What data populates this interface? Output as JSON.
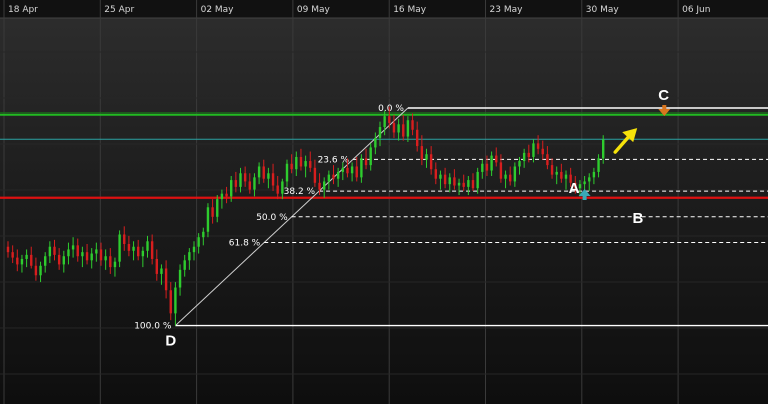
{
  "colors": {
    "up": "#2ecc2e",
    "down": "#d81e1e",
    "grid": "#3a3a3a",
    "fib_line": "#ffffff",
    "retracement_line": "#cfcfcf",
    "resistance_green": "#22bb22",
    "support_red": "#dd1111",
    "cyan_line": "#2aa3a3",
    "arrow_yellow": "#f5e20a",
    "marker_orange": "#d9761e",
    "marker_cyan": "#3aa9b5"
  },
  "chart_data": {
    "type": "candlestick",
    "x_labels": [
      "18 Apr",
      "25 Apr",
      "02 May",
      "09 May",
      "16 May",
      "23 May",
      "30 May",
      "06 Jun"
    ],
    "ylim": [
      1.2,
      1.45
    ],
    "fib_levels": [
      {
        "label": "0.0 %",
        "ratio": 0.0
      },
      {
        "label": "23.6 %",
        "ratio": 0.236
      },
      {
        "label": "38.2 %",
        "ratio": 0.382
      },
      {
        "label": "50.0 %",
        "ratio": 0.5
      },
      {
        "label": "61.8 %",
        "ratio": 0.618
      },
      {
        "label": "100.0 %",
        "ratio": 1.0
      }
    ],
    "fib_high": 1.4,
    "fib_low": 1.24,
    "levels": {
      "resistance_green": 1.395,
      "cyan": 1.377,
      "support_red": 1.334
    },
    "points": [
      {
        "label": "A",
        "index": 124,
        "price": 1.336,
        "marker": "up"
      },
      {
        "label": "B",
        "index": 133,
        "price": 1.328,
        "marker": "none"
      },
      {
        "label": "C",
        "index": 142,
        "price": 1.4,
        "marker": "down"
      },
      {
        "label": "D",
        "index": 36,
        "price": 1.24,
        "marker": "none"
      }
    ],
    "candles": [
      [
        1.298,
        1.302,
        1.29,
        1.294
      ],
      [
        1.294,
        1.299,
        1.286,
        1.29
      ],
      [
        1.29,
        1.296,
        1.28,
        1.285
      ],
      [
        1.285,
        1.292,
        1.279,
        1.289
      ],
      [
        1.289,
        1.296,
        1.283,
        1.292
      ],
      [
        1.292,
        1.298,
        1.282,
        1.284
      ],
      [
        1.284,
        1.29,
        1.273,
        1.277
      ],
      [
        1.277,
        1.287,
        1.272,
        1.284
      ],
      [
        1.284,
        1.294,
        1.279,
        1.291
      ],
      [
        1.291,
        1.302,
        1.286,
        1.298
      ],
      [
        1.298,
        1.303,
        1.288,
        1.292
      ],
      [
        1.292,
        1.297,
        1.281,
        1.285
      ],
      [
        1.285,
        1.295,
        1.279,
        1.291
      ],
      [
        1.291,
        1.301,
        1.285,
        1.296
      ],
      [
        1.296,
        1.305,
        1.29,
        1.299
      ],
      [
        1.299,
        1.304,
        1.287,
        1.291
      ],
      [
        1.291,
        1.298,
        1.283,
        1.294
      ],
      [
        1.294,
        1.3,
        1.285,
        1.288
      ],
      [
        1.288,
        1.297,
        1.282,
        1.293
      ],
      [
        1.293,
        1.301,
        1.287,
        1.296
      ],
      [
        1.296,
        1.301,
        1.284,
        1.288
      ],
      [
        1.288,
        1.296,
        1.281,
        1.291
      ],
      [
        1.291,
        1.297,
        1.278,
        1.283
      ],
      [
        1.283,
        1.29,
        1.276,
        1.287
      ],
      [
        1.287,
        1.31,
        1.283,
        1.307
      ],
      [
        1.307,
        1.313,
        1.295,
        1.3
      ],
      [
        1.3,
        1.306,
        1.291,
        1.295
      ],
      [
        1.295,
        1.302,
        1.288,
        1.298
      ],
      [
        1.298,
        1.303,
        1.288,
        1.291
      ],
      [
        1.291,
        1.298,
        1.283,
        1.295
      ],
      [
        1.295,
        1.306,
        1.29,
        1.302
      ],
      [
        1.302,
        1.307,
        1.285,
        1.289
      ],
      [
        1.289,
        1.296,
        1.273,
        1.278
      ],
      [
        1.278,
        1.285,
        1.27,
        1.282
      ],
      [
        1.282,
        1.288,
        1.26,
        1.266
      ],
      [
        1.266,
        1.272,
        1.244,
        1.249
      ],
      [
        1.249,
        1.272,
        1.24,
        1.268
      ],
      [
        1.268,
        1.285,
        1.262,
        1.281
      ],
      [
        1.281,
        1.292,
        1.276,
        1.288
      ],
      [
        1.288,
        1.297,
        1.281,
        1.294
      ],
      [
        1.294,
        1.302,
        1.288,
        1.298
      ],
      [
        1.298,
        1.308,
        1.293,
        1.305
      ],
      [
        1.305,
        1.312,
        1.299,
        1.309
      ],
      [
        1.309,
        1.33,
        1.305,
        1.327
      ],
      [
        1.327,
        1.333,
        1.315,
        1.32
      ],
      [
        1.32,
        1.336,
        1.316,
        1.333
      ],
      [
        1.333,
        1.34,
        1.326,
        1.337
      ],
      [
        1.337,
        1.342,
        1.33,
        1.335
      ],
      [
        1.335,
        1.35,
        1.331,
        1.347
      ],
      [
        1.347,
        1.353,
        1.338,
        1.342
      ],
      [
        1.342,
        1.356,
        1.338,
        1.352
      ],
      [
        1.352,
        1.357,
        1.342,
        1.346
      ],
      [
        1.346,
        1.352,
        1.337,
        1.34
      ],
      [
        1.34,
        1.352,
        1.335,
        1.349
      ],
      [
        1.349,
        1.36,
        1.344,
        1.357
      ],
      [
        1.357,
        1.362,
        1.345,
        1.348
      ],
      [
        1.348,
        1.356,
        1.341,
        1.352
      ],
      [
        1.352,
        1.359,
        1.339,
        1.343
      ],
      [
        1.343,
        1.35,
        1.333,
        1.337
      ],
      [
        1.337,
        1.348,
        1.333,
        1.346
      ],
      [
        1.346,
        1.362,
        1.342,
        1.359
      ],
      [
        1.359,
        1.366,
        1.352,
        1.355
      ],
      [
        1.355,
        1.368,
        1.35,
        1.364
      ],
      [
        1.364,
        1.37,
        1.354,
        1.357
      ],
      [
        1.357,
        1.365,
        1.349,
        1.361
      ],
      [
        1.361,
        1.368,
        1.353,
        1.356
      ],
      [
        1.356,
        1.362,
        1.342,
        1.345
      ],
      [
        1.345,
        1.352,
        1.336,
        1.34
      ],
      [
        1.34,
        1.349,
        1.334,
        1.346
      ],
      [
        1.346,
        1.354,
        1.34,
        1.351
      ],
      [
        1.351,
        1.358,
        1.344,
        1.348
      ],
      [
        1.348,
        1.356,
        1.342,
        1.353
      ],
      [
        1.353,
        1.36,
        1.347,
        1.356
      ],
      [
        1.356,
        1.363,
        1.349,
        1.352
      ],
      [
        1.352,
        1.36,
        1.346,
        1.357
      ],
      [
        1.357,
        1.364,
        1.346,
        1.349
      ],
      [
        1.349,
        1.366,
        1.345,
        1.363
      ],
      [
        1.363,
        1.37,
        1.355,
        1.358
      ],
      [
        1.358,
        1.374,
        1.354,
        1.371
      ],
      [
        1.371,
        1.382,
        1.366,
        1.378
      ],
      [
        1.378,
        1.39,
        1.372,
        1.386
      ],
      [
        1.386,
        1.398,
        1.38,
        1.394
      ],
      [
        1.394,
        1.401,
        1.385,
        1.389
      ],
      [
        1.389,
        1.395,
        1.378,
        1.382
      ],
      [
        1.382,
        1.392,
        1.376,
        1.388
      ],
      [
        1.388,
        1.395,
        1.376,
        1.379
      ],
      [
        1.379,
        1.394,
        1.375,
        1.391
      ],
      [
        1.391,
        1.396,
        1.38,
        1.384
      ],
      [
        1.384,
        1.39,
        1.368,
        1.372
      ],
      [
        1.372,
        1.38,
        1.358,
        1.362
      ],
      [
        1.362,
        1.37,
        1.356,
        1.366
      ],
      [
        1.366,
        1.372,
        1.351,
        1.355
      ],
      [
        1.355,
        1.36,
        1.344,
        1.348
      ],
      [
        1.348,
        1.354,
        1.34,
        1.351
      ],
      [
        1.351,
        1.356,
        1.341,
        1.344
      ],
      [
        1.344,
        1.352,
        1.338,
        1.349
      ],
      [
        1.349,
        1.355,
        1.34,
        1.343
      ],
      [
        1.343,
        1.348,
        1.336,
        1.345
      ],
      [
        1.345,
        1.351,
        1.339,
        1.342
      ],
      [
        1.342,
        1.35,
        1.336,
        1.347
      ],
      [
        1.347,
        1.352,
        1.339,
        1.341
      ],
      [
        1.341,
        1.356,
        1.337,
        1.353
      ],
      [
        1.353,
        1.362,
        1.348,
        1.359
      ],
      [
        1.359,
        1.365,
        1.35,
        1.354
      ],
      [
        1.354,
        1.368,
        1.35,
        1.365
      ],
      [
        1.365,
        1.371,
        1.357,
        1.36
      ],
      [
        1.36,
        1.366,
        1.345,
        1.348
      ],
      [
        1.348,
        1.354,
        1.341,
        1.351
      ],
      [
        1.351,
        1.357,
        1.343,
        1.346
      ],
      [
        1.346,
        1.36,
        1.342,
        1.357
      ],
      [
        1.357,
        1.364,
        1.351,
        1.361
      ],
      [
        1.361,
        1.37,
        1.356,
        1.367
      ],
      [
        1.367,
        1.373,
        1.36,
        1.364
      ],
      [
        1.364,
        1.377,
        1.36,
        1.374
      ],
      [
        1.374,
        1.38,
        1.366,
        1.37
      ],
      [
        1.37,
        1.376,
        1.362,
        1.366
      ],
      [
        1.366,
        1.372,
        1.355,
        1.358
      ],
      [
        1.358,
        1.363,
        1.348,
        1.351
      ],
      [
        1.351,
        1.357,
        1.344,
        1.353
      ],
      [
        1.353,
        1.359,
        1.345,
        1.348
      ],
      [
        1.348,
        1.354,
        1.34,
        1.351
      ],
      [
        1.351,
        1.356,
        1.342,
        1.345
      ],
      [
        1.345,
        1.35,
        1.337,
        1.341
      ],
      [
        1.341,
        1.347,
        1.335,
        1.344
      ],
      [
        1.344,
        1.35,
        1.338,
        1.346
      ],
      [
        1.346,
        1.352,
        1.339,
        1.349
      ],
      [
        1.349,
        1.356,
        1.344,
        1.353
      ],
      [
        1.353,
        1.366,
        1.349,
        1.363
      ],
      [
        1.363,
        1.38,
        1.359,
        1.377
      ]
    ]
  }
}
